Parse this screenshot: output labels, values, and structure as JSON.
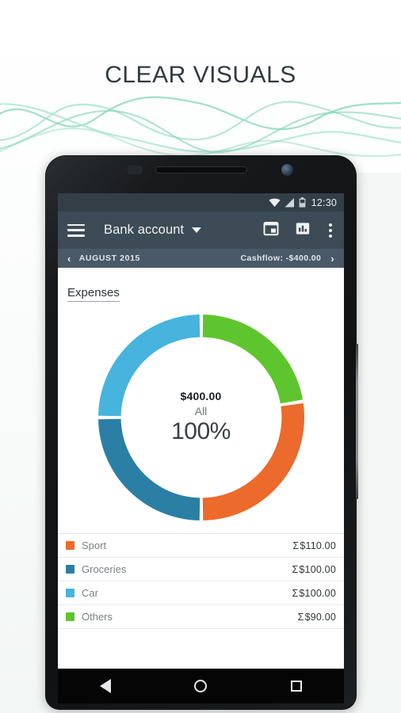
{
  "promo": {
    "title": "CLEAR VISUALS"
  },
  "status_bar": {
    "wifi_icon": "wifi-icon",
    "signal_icon": "cell-signal-icon",
    "battery_icon": "battery-icon",
    "time": "12:30"
  },
  "app_bar": {
    "menu_icon": "hamburger-menu-icon",
    "title": "Bank account",
    "dropdown_icon": "chevron-down-icon",
    "calendar_icon": "calendar-icon",
    "chart_icon": "bar-chart-icon",
    "overflow_icon": "more-vertical-icon"
  },
  "month_bar": {
    "prev_icon": "chevron-left-icon",
    "month": "AUGUST 2015",
    "cashflow": "Cashflow: -$400.00",
    "next_icon": "chevron-right-icon"
  },
  "content": {
    "section_title": "Expenses",
    "center": {
      "amount": "$400.00",
      "label": "All",
      "percent": "100%"
    }
  },
  "legend": {
    "rows": [
      {
        "name": "Sport",
        "amount": "$110.00",
        "sigma": "Σ",
        "color": "#ec6a2b"
      },
      {
        "name": "Groceries",
        "amount": "$100.00",
        "sigma": "Σ",
        "color": "#2b7fa4"
      },
      {
        "name": "Car",
        "amount": "$100.00",
        "sigma": "Σ",
        "color": "#46b4dc"
      },
      {
        "name": "Others",
        "amount": "$90.00",
        "sigma": "Σ",
        "color": "#5fc52e"
      }
    ]
  },
  "nav_bar": {
    "back_icon": "back-triangle-icon",
    "home_icon": "home-circle-icon",
    "recents_icon": "recents-square-icon"
  },
  "colors": {
    "status_bar": "#333f47",
    "app_bar": "#3c4b55",
    "month_bar": "#4a5967",
    "sport": "#ec6a2b",
    "groceries": "#2b7fa4",
    "car": "#46b4dc",
    "others": "#5fc52e",
    "wave": "#7fd3b6"
  },
  "chart_data": {
    "type": "pie",
    "title": "Expenses",
    "subtitle": "All",
    "total": 400.0,
    "total_label": "$400.00",
    "percent_label": "100%",
    "currency": "$",
    "donut": true,
    "inner_radius_ratio": 0.78,
    "start_angle_deg": -90,
    "direction": "clockwise",
    "categories": [
      "Others",
      "Sport",
      "Groceries",
      "Car"
    ],
    "values": [
      90,
      110,
      100,
      100
    ],
    "percentages": [
      22.5,
      27.5,
      25.0,
      25.0
    ],
    "colors": [
      "#5fc52e",
      "#ec6a2b",
      "#2b7fa4",
      "#46b4dc"
    ],
    "labels": [
      "$90.00",
      "$110.00",
      "$100.00",
      "$100.00"
    ],
    "legend_position": "bottom",
    "grid": false
  }
}
